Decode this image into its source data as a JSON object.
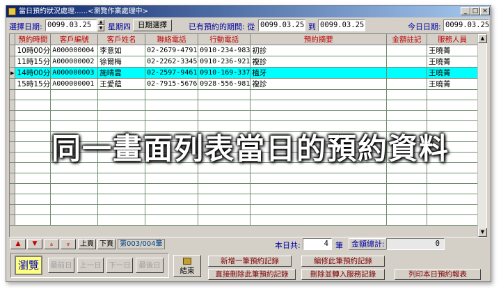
{
  "window": {
    "title": "當日預約狀況處理......<瀏覽作業處理中>",
    "min_label": "_",
    "max_label": "□",
    "close_label": "×"
  },
  "toolbar": {
    "select_date_label": "選擇日期:",
    "select_date_value": "0099.03.25",
    "weekday": "星期四",
    "date_pick_button": "日期選擇",
    "period_label": "已有預約的期間: 從",
    "period_from": "0099.03.25",
    "period_to_label": "到",
    "period_to": "0099.03.25",
    "today_label": "今日日期:",
    "today_value": "0099.03.25"
  },
  "grid": {
    "columns": [
      "預約時間",
      "客戶編號",
      "客戶姓名",
      "聯絡電話",
      "行動電話",
      "預約摘要",
      "金額註記",
      "服務人員"
    ],
    "rows": [
      {
        "time": "10時00分",
        "cust_no": "A000000004",
        "name": "李意如",
        "phone": "02-2679-4791",
        "mobile": "0910-234-983",
        "summary": "初診",
        "amount": "",
        "staff": "王曉菁"
      },
      {
        "time": "11時15分",
        "cust_no": "A000000002",
        "name": "徐爾梅",
        "phone": "02-2262-3345",
        "mobile": "0910-236-921",
        "summary": "複診",
        "amount": "",
        "staff": "王曉菁"
      },
      {
        "time": "14時00分",
        "cust_no": "A000000003",
        "name": "施晴雲",
        "phone": "02-2597-9461",
        "mobile": "0910-169-337",
        "summary": "植牙",
        "amount": "",
        "staff": "王曉菁"
      },
      {
        "time": "15時15分",
        "cust_no": "A000000001",
        "name": "王愛蘊",
        "phone": "02-7915-5676",
        "mobile": "0928-556-981",
        "summary": "複診",
        "amount": "",
        "staff": "王曉菁"
      }
    ],
    "selected_row": 2,
    "selected_color": "#00ffff"
  },
  "overlay_text": "同一畫面列表當日的預約資料",
  "nav": {
    "prev_page": "上頁",
    "next_page": "下頁",
    "record_counter": "第003/004筆"
  },
  "summary": {
    "today_total_label": "本日共:",
    "today_total_value": "4",
    "unit": "筆",
    "amount_total_label": "金額總計:",
    "amount_total_value": "0"
  },
  "bottom": {
    "browse_label": "瀏覽",
    "first_day": "最前日",
    "prev_day": "上一日",
    "next_day": "下一日",
    "last_day": "最後日",
    "exit_label": "結束",
    "add_record": "新增一筆預約記錄",
    "edit_record": "編修此筆預約記錄",
    "delete_record": "直接刪除此筆預約記錄",
    "delete_transfer": "刪除並轉入服務記錄",
    "print_report": "列印本日預約報表"
  }
}
